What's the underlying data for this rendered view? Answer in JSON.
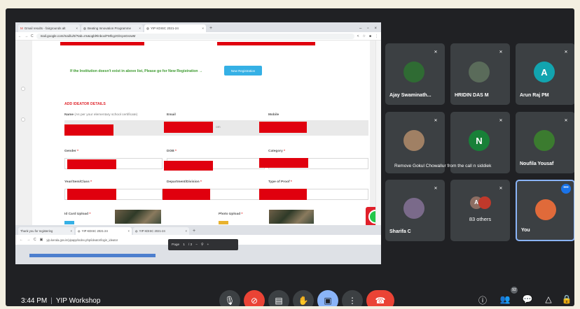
{
  "browser": {
    "tabs": [
      {
        "label": "Gmail results - fairgrounds alt",
        "active": false
      },
      {
        "label": "Beating Innovation Programme",
        "active": false
      },
      {
        "label": "YIP KDISC 2021-24",
        "active": true
      }
    ],
    "url": "mail.google.com/mail/u/0/?tab=rm&ogbl#inbox/FMfcgzGlrcpsGsrwM",
    "form": {
      "institution_message": "If the Institution doesn't exist in above list, Please go for New Registration →",
      "new_registration_button": "New Registration",
      "section_title": "ADD IDEATOR DETAILS",
      "fields": {
        "name": "Name",
        "name_hint": "(As per your elementary school certificate)",
        "email": "Email",
        "mobile": "Mobile",
        "gender": "Gender",
        "dob": "DOB",
        "category": "Category",
        "year": "Year/Sem/Class",
        "department": "Department/Division",
        "proof_type": "Type of Proof",
        "id_card": "Id Card Upload",
        "photo": "Photo Upload"
      },
      "required_mark": "*",
      "email_suffix": "om"
    }
  },
  "browser2": {
    "tabs": [
      {
        "label": "Thank you for registering",
        "active": false
      },
      {
        "label": "YIP KDISC 2021-24",
        "active": true
      },
      {
        "label": "YIP KDISC 2021-24",
        "active": false
      }
    ],
    "url": "yip.kerala.gov.in/yipapp/index.php/ideator/login_ideator",
    "pdf_toolbar": {
      "page_label": "Page",
      "page_current": "1",
      "page_total": "/ 3"
    }
  },
  "participants": [
    {
      "name": "Ajay Swaminath...",
      "avatar": "photo",
      "color": "#2f6b33"
    },
    {
      "name": "HRIDIN DAS M",
      "avatar": "photo",
      "color": "#5a6b5a"
    },
    {
      "name": "Arun Raj PM",
      "avatar": "A",
      "color": "#12a4af"
    },
    {
      "name": "",
      "avatar": "photo",
      "color": "#a08064"
    },
    {
      "name": "",
      "avatar": "N",
      "color": "#188038"
    },
    {
      "name": "Noufila Yousaf",
      "avatar": "photo",
      "color": "#3b7b2f"
    },
    {
      "name": "Sharifa C",
      "avatar": "photo",
      "color": "#7a6a8a"
    },
    {
      "others": "83 others",
      "stack": [
        "A",
        ""
      ]
    },
    {
      "name": "You",
      "avatar": "photo",
      "color": "#e06a3a"
    }
  ],
  "toast": "Remove Gokul Chowallur from the call",
  "toast_trailing": "n siddiek",
  "meeting": {
    "time": "3:44 PM",
    "separator": "|",
    "title": "YIP Workshop"
  },
  "controls": [
    "mic-icon",
    "camera-off-icon",
    "captions-icon",
    "raise-hand-icon",
    "present-icon",
    "more-options-icon",
    "end-call-icon"
  ],
  "right_icons": [
    "info-icon",
    "people-icon",
    "chat-icon",
    "activities-icon",
    "host-controls-icon"
  ],
  "people_count": "92",
  "colors": {
    "accent_red": "#ea4335",
    "accent_blue": "#8ab4f8",
    "tile_bg": "#3c4043",
    "redaction": "#e0000e"
  }
}
